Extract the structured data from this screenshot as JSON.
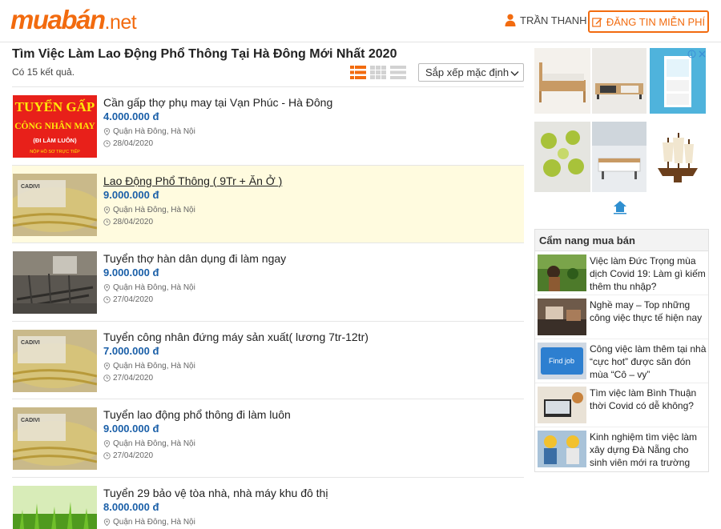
{
  "header": {
    "logo_main": "muabán",
    "logo_tld": ".net",
    "user_name": "TRẦN THANH",
    "post_button": "ĐĂNG TIN MIỄN PHÍ"
  },
  "page": {
    "title": "Tìm Việc Làm Lao Động Phổ Thông Tại Hà Đông Mới Nhất 2020",
    "count": "Có 15 kết quả.",
    "sort_selected": "Sắp xếp mặc định",
    "view_modes": [
      "list-view-icon",
      "grid-view-icon",
      "compact-view-icon"
    ]
  },
  "listings": [
    {
      "title": "Cần gấp thợ phụ may tại Vạn Phúc - Hà Đông",
      "price": "4.000.000 đ",
      "location": "Quận Hà Đông, Hà Nội",
      "date": "28/04/2020",
      "thumb_lines": [
        "TUYỂN GẤP",
        "CÔNG NHÂN MAY",
        "(ĐI LÀM LUÔN)",
        "NỘP HỒ SƠ TRỰC TIẾP"
      ]
    },
    {
      "title": "Lao Động Phổ Thông ( 9Tr + Ăn Ở )",
      "price": "9.000.000 đ",
      "location": "Quận Hà Đông, Hà Nội",
      "date": "28/04/2020",
      "highlighted": true
    },
    {
      "title": "Tuyển thợ hàn dân dụng đi làm ngay",
      "price": "9.000.000 đ",
      "location": "Quận Hà Đông, Hà Nội",
      "date": "27/04/2020"
    },
    {
      "title": "Tuyển công nhân đứng máy sản xuất( lương 7tr-12tr)",
      "price": "7.000.000 đ",
      "location": "Quận Hà Đông, Hà Nội",
      "date": "27/04/2020"
    },
    {
      "title": "Tuyển lao động phổ thông đi làm luôn",
      "price": "9.000.000 đ",
      "location": "Quận Hà Đông, Hà Nội",
      "date": "27/04/2020"
    },
    {
      "title": "Tuyển 29 bảo vệ tòa nhà, nhà máy khu đô thị",
      "price": "8.000.000 đ",
      "location": "Quận Hà Đông, Hà Nội",
      "date": ""
    }
  ],
  "guide": {
    "heading": "Cẩm nang mua bán",
    "items": [
      {
        "title": "Việc làm Đức Trọng mùa dịch Covid 19: Làm gì kiếm thêm thu nhập?"
      },
      {
        "title": "Nghề may – Top những công việc thực tế hiện nay"
      },
      {
        "title": "Công việc làm thêm tại nhà “cực hot” được săn đón mùa “Cô – vy”",
        "thumb_label": "Find job"
      },
      {
        "title": "Tìm việc làm Bình Thuận thời Covid có dễ không?"
      },
      {
        "title": "Kinh nghiệm tìm việc làm xây dựng Đà Nẵng cho sinh viên mới ra trường"
      }
    ]
  },
  "colors": {
    "brand": "#f26b0f",
    "price": "#1a5fa8",
    "highlight_bg": "#fffbdf"
  }
}
